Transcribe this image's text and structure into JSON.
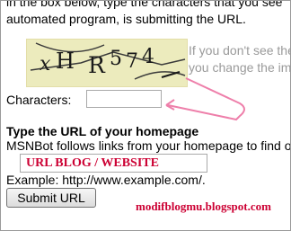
{
  "instructions": {
    "line1": "in the box below, type the characters that you see",
    "line2": "automated program, is submitting the URL."
  },
  "captcha": {
    "text": "xH R574"
  },
  "captcha_note": {
    "line1": "If you don't see the",
    "line2": "you change the im"
  },
  "characters": {
    "label": "Characters:",
    "value": ""
  },
  "url_section": {
    "heading": "Type the URL of your homepage",
    "description": "MSNBot follows links from your homepage to find o",
    "field_value": "URL BLOG / WEBSITE",
    "example": "Example: http://www.example.com/."
  },
  "submit": {
    "label": "Submit URL"
  },
  "watermark": {
    "text": "modifblogmu.blogspot.com"
  },
  "colors": {
    "annotation": "#cc0033",
    "captcha_bg": "#ecebbd",
    "arrow": "#ee7faa"
  }
}
